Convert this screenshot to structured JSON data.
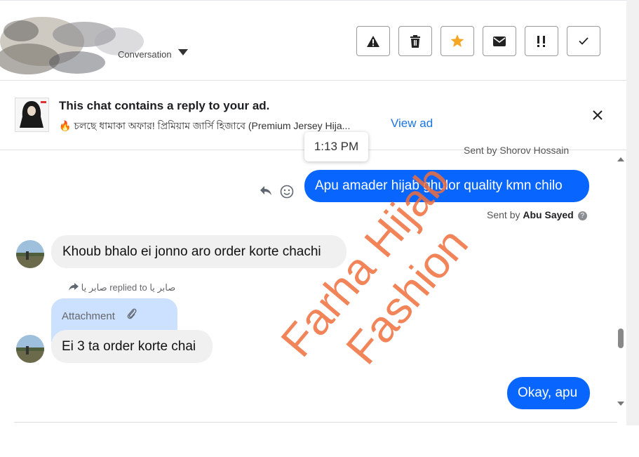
{
  "header": {
    "conversation_label": "Conversation",
    "toolbar": [
      {
        "name": "report-button",
        "icon": "warning-icon"
      },
      {
        "name": "delete-button",
        "icon": "trash-icon"
      },
      {
        "name": "star-button",
        "icon": "star-icon"
      },
      {
        "name": "mark-unread-button",
        "icon": "envelope-icon"
      },
      {
        "name": "spam-button",
        "icon": "spam-icon"
      },
      {
        "name": "done-button",
        "icon": "check-icon"
      }
    ]
  },
  "ad_banner": {
    "title": "This chat contains a reply to your ad.",
    "subtitle": "🔥 চলছে ধামাকা অফার! প্রিমিয়াম জার্সি হিজাবে (Premium Jersey Hija...",
    "view_ad": "View ad"
  },
  "timestamp_tooltip": "1:13 PM",
  "messages": {
    "sent_top": "Sent by Shorov Hossain",
    "msg1": "Apu amader hijab ghulor quality kmn chilo",
    "sent_by_prefix": "Sent by",
    "sent_by_name": "Abu Sayed",
    "msg2": "Khoub bhalo ei jonno aro order korte chachi",
    "replied_text": "صابر يا replied to صابر يا",
    "attachment_label": "Attachment",
    "msg3": "Ei 3 ta order korte chai",
    "msg4": "Okay, apu"
  },
  "watermark": {
    "line1": "Farha Hijab",
    "line2": "Fashion"
  },
  "colors": {
    "accent": "#0866ff",
    "star": "#f5a623",
    "watermark": "#f06e3c"
  }
}
